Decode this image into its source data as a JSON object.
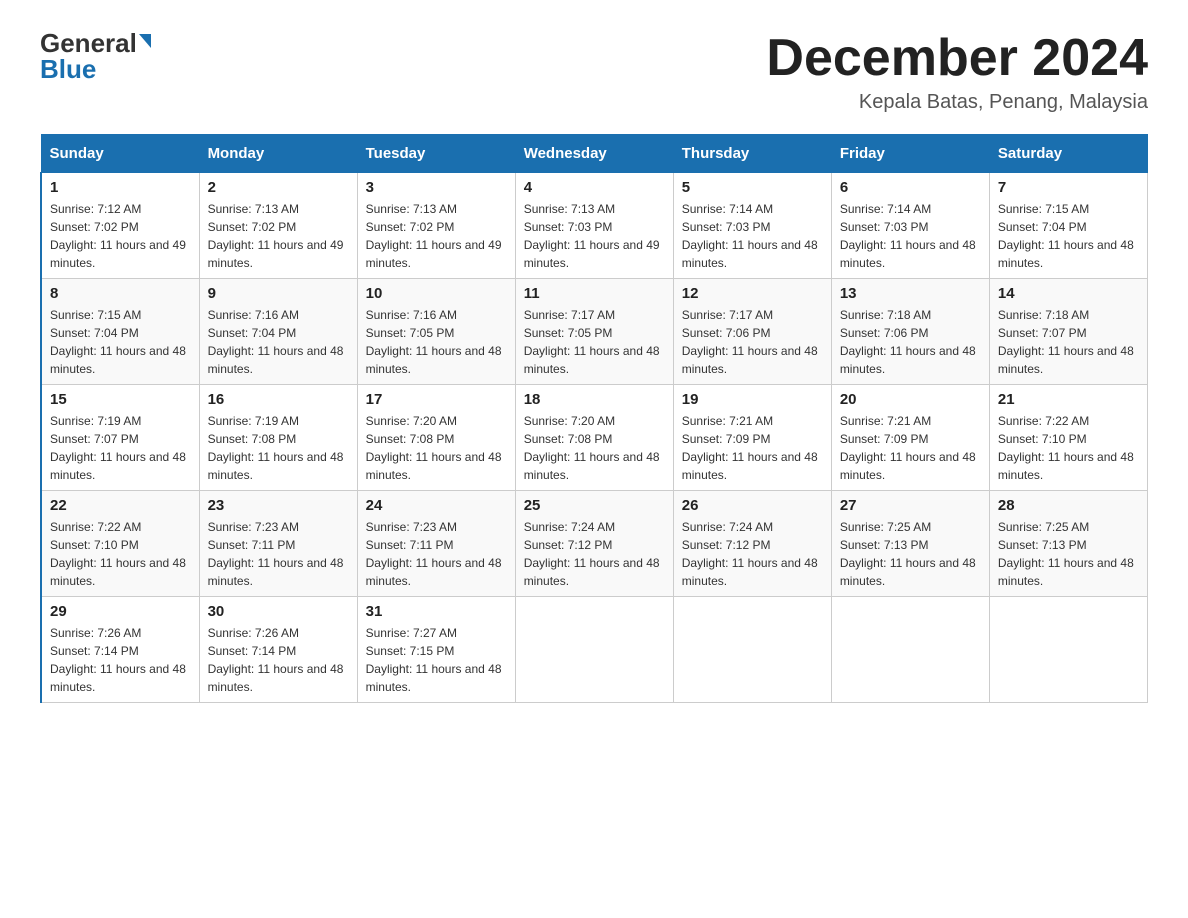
{
  "header": {
    "logo_general": "General",
    "logo_blue": "Blue",
    "month_title": "December 2024",
    "location": "Kepala Batas, Penang, Malaysia"
  },
  "calendar": {
    "days_of_week": [
      "Sunday",
      "Monday",
      "Tuesday",
      "Wednesday",
      "Thursday",
      "Friday",
      "Saturday"
    ],
    "weeks": [
      [
        {
          "day": "1",
          "sunrise": "7:12 AM",
          "sunset": "7:02 PM",
          "daylight": "11 hours and 49 minutes."
        },
        {
          "day": "2",
          "sunrise": "7:13 AM",
          "sunset": "7:02 PM",
          "daylight": "11 hours and 49 minutes."
        },
        {
          "day": "3",
          "sunrise": "7:13 AM",
          "sunset": "7:02 PM",
          "daylight": "11 hours and 49 minutes."
        },
        {
          "day": "4",
          "sunrise": "7:13 AM",
          "sunset": "7:03 PM",
          "daylight": "11 hours and 49 minutes."
        },
        {
          "day": "5",
          "sunrise": "7:14 AM",
          "sunset": "7:03 PM",
          "daylight": "11 hours and 48 minutes."
        },
        {
          "day": "6",
          "sunrise": "7:14 AM",
          "sunset": "7:03 PM",
          "daylight": "11 hours and 48 minutes."
        },
        {
          "day": "7",
          "sunrise": "7:15 AM",
          "sunset": "7:04 PM",
          "daylight": "11 hours and 48 minutes."
        }
      ],
      [
        {
          "day": "8",
          "sunrise": "7:15 AM",
          "sunset": "7:04 PM",
          "daylight": "11 hours and 48 minutes."
        },
        {
          "day": "9",
          "sunrise": "7:16 AM",
          "sunset": "7:04 PM",
          "daylight": "11 hours and 48 minutes."
        },
        {
          "day": "10",
          "sunrise": "7:16 AM",
          "sunset": "7:05 PM",
          "daylight": "11 hours and 48 minutes."
        },
        {
          "day": "11",
          "sunrise": "7:17 AM",
          "sunset": "7:05 PM",
          "daylight": "11 hours and 48 minutes."
        },
        {
          "day": "12",
          "sunrise": "7:17 AM",
          "sunset": "7:06 PM",
          "daylight": "11 hours and 48 minutes."
        },
        {
          "day": "13",
          "sunrise": "7:18 AM",
          "sunset": "7:06 PM",
          "daylight": "11 hours and 48 minutes."
        },
        {
          "day": "14",
          "sunrise": "7:18 AM",
          "sunset": "7:07 PM",
          "daylight": "11 hours and 48 minutes."
        }
      ],
      [
        {
          "day": "15",
          "sunrise": "7:19 AM",
          "sunset": "7:07 PM",
          "daylight": "11 hours and 48 minutes."
        },
        {
          "day": "16",
          "sunrise": "7:19 AM",
          "sunset": "7:08 PM",
          "daylight": "11 hours and 48 minutes."
        },
        {
          "day": "17",
          "sunrise": "7:20 AM",
          "sunset": "7:08 PM",
          "daylight": "11 hours and 48 minutes."
        },
        {
          "day": "18",
          "sunrise": "7:20 AM",
          "sunset": "7:08 PM",
          "daylight": "11 hours and 48 minutes."
        },
        {
          "day": "19",
          "sunrise": "7:21 AM",
          "sunset": "7:09 PM",
          "daylight": "11 hours and 48 minutes."
        },
        {
          "day": "20",
          "sunrise": "7:21 AM",
          "sunset": "7:09 PM",
          "daylight": "11 hours and 48 minutes."
        },
        {
          "day": "21",
          "sunrise": "7:22 AM",
          "sunset": "7:10 PM",
          "daylight": "11 hours and 48 minutes."
        }
      ],
      [
        {
          "day": "22",
          "sunrise": "7:22 AM",
          "sunset": "7:10 PM",
          "daylight": "11 hours and 48 minutes."
        },
        {
          "day": "23",
          "sunrise": "7:23 AM",
          "sunset": "7:11 PM",
          "daylight": "11 hours and 48 minutes."
        },
        {
          "day": "24",
          "sunrise": "7:23 AM",
          "sunset": "7:11 PM",
          "daylight": "11 hours and 48 minutes."
        },
        {
          "day": "25",
          "sunrise": "7:24 AM",
          "sunset": "7:12 PM",
          "daylight": "11 hours and 48 minutes."
        },
        {
          "day": "26",
          "sunrise": "7:24 AM",
          "sunset": "7:12 PM",
          "daylight": "11 hours and 48 minutes."
        },
        {
          "day": "27",
          "sunrise": "7:25 AM",
          "sunset": "7:13 PM",
          "daylight": "11 hours and 48 minutes."
        },
        {
          "day": "28",
          "sunrise": "7:25 AM",
          "sunset": "7:13 PM",
          "daylight": "11 hours and 48 minutes."
        }
      ],
      [
        {
          "day": "29",
          "sunrise": "7:26 AM",
          "sunset": "7:14 PM",
          "daylight": "11 hours and 48 minutes."
        },
        {
          "day": "30",
          "sunrise": "7:26 AM",
          "sunset": "7:14 PM",
          "daylight": "11 hours and 48 minutes."
        },
        {
          "day": "31",
          "sunrise": "7:27 AM",
          "sunset": "7:15 PM",
          "daylight": "11 hours and 48 minutes."
        },
        null,
        null,
        null,
        null
      ]
    ]
  }
}
